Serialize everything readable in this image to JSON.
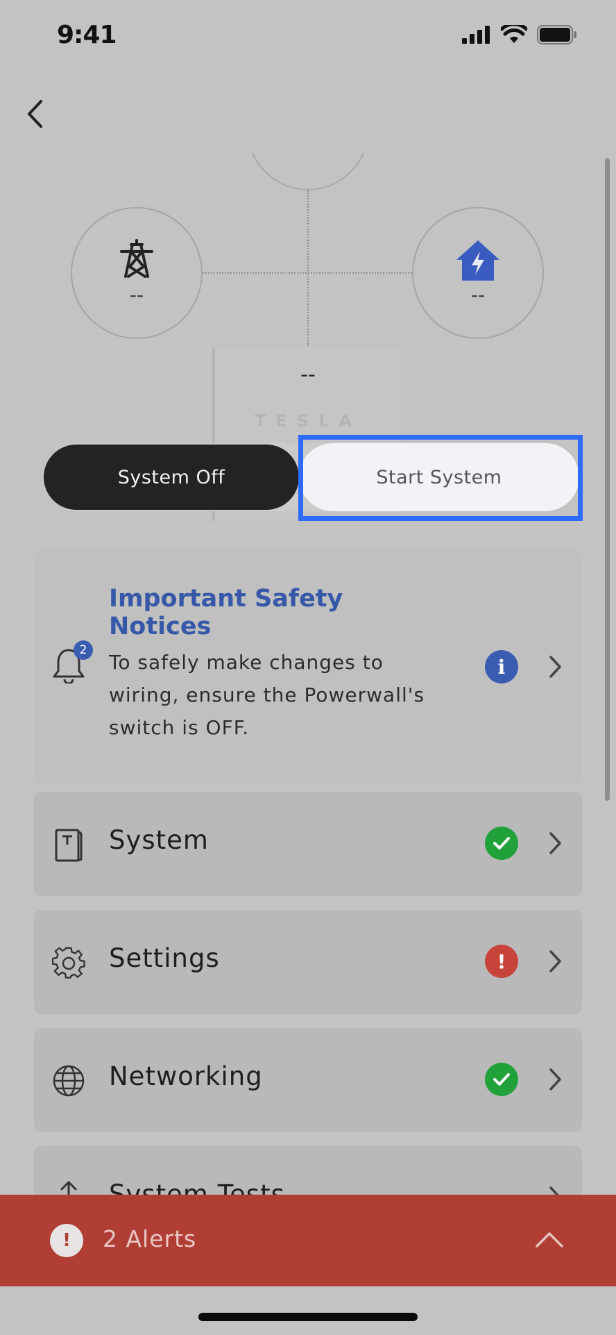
{
  "status_bar": {
    "time": "9:41"
  },
  "diagram": {
    "grid_value": "--",
    "home_value": "--",
    "powerwall_value": "--",
    "powerwall_logo": "TESLA"
  },
  "toggle": {
    "off_label": "System Off",
    "start_label": "Start System"
  },
  "safety": {
    "title": "Important Safety Notices",
    "body": "To safely make changes to wiring, ensure the Powerwall's switch is OFF.",
    "badge_count": "2",
    "info_icon": "i"
  },
  "rows": [
    {
      "label": "System",
      "status": "ok",
      "color": "#21a13a"
    },
    {
      "label": "Settings",
      "status": "error",
      "color": "#c8443a"
    },
    {
      "label": "Networking",
      "status": "ok",
      "color": "#21a13a"
    },
    {
      "label": "System Tests"
    }
  ],
  "alerts": {
    "label": "2 Alerts",
    "icon": "!"
  },
  "colors": {
    "accent_blue": "#3758a8",
    "highlight": "#2f6bff",
    "alert_red": "#b13e35",
    "ok_green": "#21a13a"
  }
}
